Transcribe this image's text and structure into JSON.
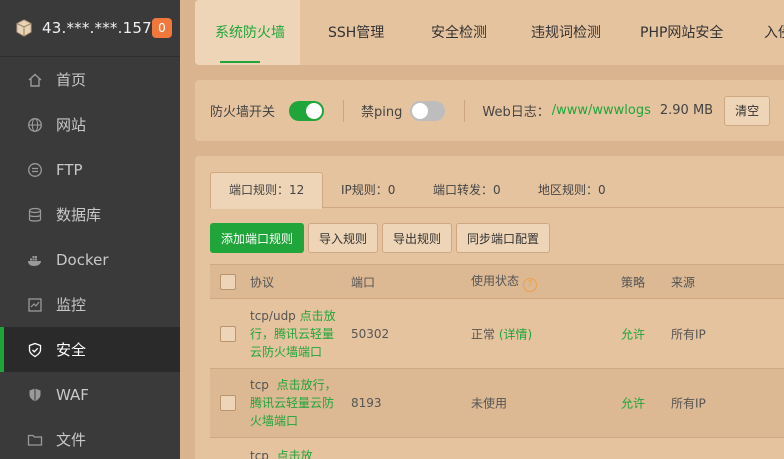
{
  "sidebar": {
    "server_ip": "43.***.***.157",
    "badge": "0",
    "items": [
      {
        "label": "首页",
        "icon": "home-icon"
      },
      {
        "label": "网站",
        "icon": "globe-icon"
      },
      {
        "label": "FTP",
        "icon": "ftp-icon"
      },
      {
        "label": "数据库",
        "icon": "database-icon"
      },
      {
        "label": "Docker",
        "icon": "docker-icon"
      },
      {
        "label": "监控",
        "icon": "monitor-icon"
      },
      {
        "label": "安全",
        "icon": "shield-icon",
        "active": true
      },
      {
        "label": "WAF",
        "icon": "waf-shield-icon"
      },
      {
        "label": "文件",
        "icon": "folder-icon"
      }
    ]
  },
  "tabs": [
    "系统防火墙",
    "SSH管理",
    "安全检测",
    "违规词检测",
    "PHP网站安全",
    "入侵"
  ],
  "firewall": {
    "switch_label": "防火墙开关",
    "switch_on": true,
    "ping_label": "禁ping",
    "ping_on": false,
    "log_label": "Web日志：",
    "log_path": "/www/wwwlogs",
    "log_size": "2.90 MB",
    "clear_label": "清空"
  },
  "subtabs": [
    "端口规则：12",
    "IP规则：0",
    "端口转发：0",
    "地区规则：0"
  ],
  "buttons": {
    "add": "添加端口规则",
    "import": "导入规则",
    "export": "导出规则",
    "sync": "同步端口配置"
  },
  "table": {
    "headers": {
      "protocol": "协议",
      "port": "端口",
      "status": "使用状态",
      "status_help": "?",
      "policy": "策略",
      "source": "来源"
    },
    "rows": [
      {
        "protocol": "tcp/udp",
        "note": "点击放行，腾讯云轻量云防火墙端口",
        "port": "50302",
        "status": "正常",
        "status_link": "(详情)",
        "policy": "允许",
        "source": "所有IP"
      },
      {
        "protocol": "tcp",
        "note": "点击放行，腾讯云轻量云防火墙端口",
        "port": "8193",
        "status": "未使用",
        "status_link": "",
        "policy": "允许",
        "source": "所有IP"
      },
      {
        "protocol": "tcp",
        "note": "点击放",
        "port": "",
        "status": "",
        "status_link": "",
        "policy": "",
        "source": ""
      }
    ]
  },
  "colors": {
    "accent": "#20a53a",
    "sidebar_bg": "#3a3a3a",
    "badge": "#f0783c"
  }
}
